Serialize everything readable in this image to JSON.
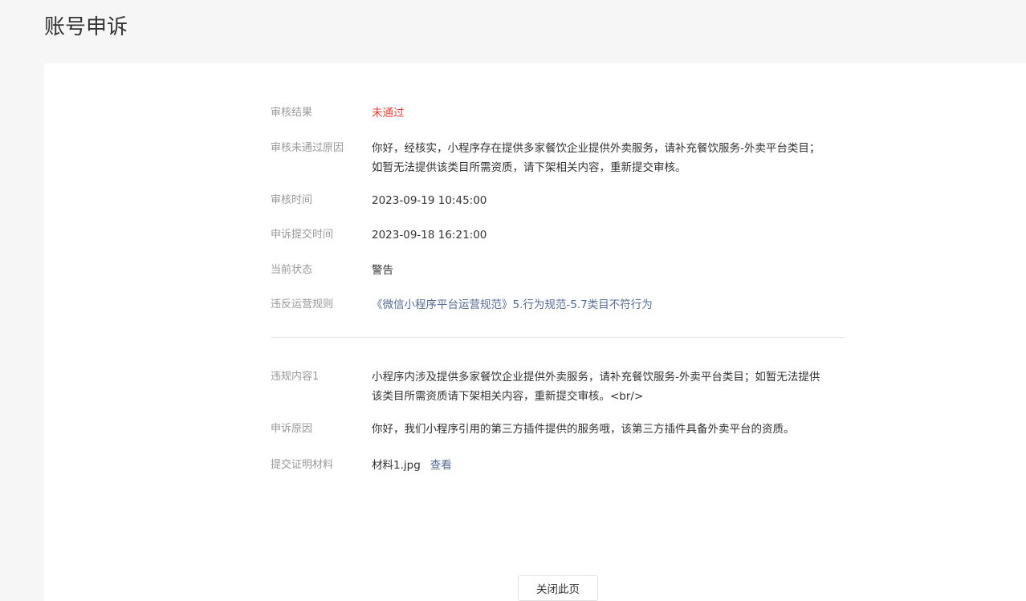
{
  "page": {
    "title": "账号申诉"
  },
  "details": {
    "result": {
      "label": "审核结果",
      "value": "未通过"
    },
    "reason": {
      "label": "审核未通过原因",
      "value_line1": "你好，经核实，小程序存在提供多家餐饮企业提供外卖服务，请补充餐饮服务-外卖平台类目；",
      "value_line2": "如暂无法提供该类目所需资质，请下架相关内容，重新提交审核。"
    },
    "review_time": {
      "label": "审核时间",
      "value": "2023-09-19 10:45:00"
    },
    "submit_time": {
      "label": "申诉提交时间",
      "value": "2023-09-18 16:21:00"
    },
    "status": {
      "label": "当前状态",
      "value": "警告"
    },
    "rule": {
      "label": "违反运营规则",
      "value": "《微信小程序平台运营规范》5.行为规范-5.7类目不符行为"
    }
  },
  "appeal": {
    "content": {
      "label": "违规内容1",
      "value_line1": "小程序内涉及提供多家餐饮企业提供外卖服务，请补充餐饮服务-外卖平台类目；如暂无法提供",
      "value_line2": "该类目所需资质请下架相关内容，重新提交审核。<br/>"
    },
    "appeal_reason": {
      "label": "申诉原因",
      "value": "你好，我们小程序引用的第三方插件提供的服务哦，该第三方插件具备外卖平台的资质。"
    },
    "materials": {
      "label": "提交证明材料",
      "file_name": "材料1.jpg",
      "view_label": "查看"
    }
  },
  "footer": {
    "close_label": "关闭此页"
  },
  "colors": {
    "status_red": "#e0463b",
    "link_blue": "#576b95",
    "label_gray": "#999999"
  }
}
